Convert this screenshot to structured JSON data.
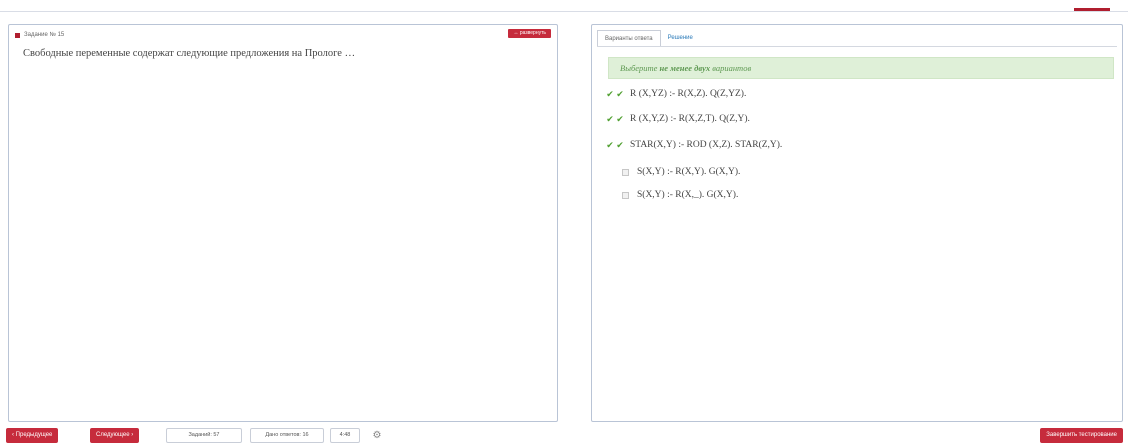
{
  "header": {
    "accent_color": "#b01e2f"
  },
  "task": {
    "title": "Задание № 15",
    "expand_label": "развернуть",
    "question": "Свободные переменные содержат следующие предложения на Прологе …"
  },
  "tabs": [
    {
      "label": "Варианты ответа",
      "active": true
    },
    {
      "label": "Решение",
      "active": false
    }
  ],
  "hint": {
    "prefix": "Выберите ",
    "bold": "не менее двух",
    "suffix": " вариантов"
  },
  "options": [
    {
      "text": "R (X,YZ) :- R(X,Z). Q(Z,YZ).",
      "checked": true
    },
    {
      "text": "R (X,Y,Z) :- R(X,Z,T). Q(Z,Y).",
      "checked": true
    },
    {
      "text": "STAR(X,Y) :- ROD (X,Z). STAR(Z,Y).",
      "checked": true
    },
    {
      "text": "S(X,Y) :- R(X,Y). G(X,Y).",
      "checked": false
    },
    {
      "text": "S(X,Y) :- R(X,_). G(X,Y).",
      "checked": false
    }
  ],
  "footer": {
    "prev_label": "‹ Предыдущее",
    "next_label": "Следующее ›",
    "tasks_label": "Заданий: 57",
    "answers_label": "Дано ответов: 16",
    "time_label": "4:48",
    "finish_label": "Завершить тестирование"
  },
  "icons": {
    "gear": "gear-icon",
    "check": "check-icon"
  },
  "colors": {
    "red": "#c62b3c",
    "green": "#4f9f2f",
    "hint_bg": "#dff0d8",
    "link": "#2b7bb9"
  }
}
